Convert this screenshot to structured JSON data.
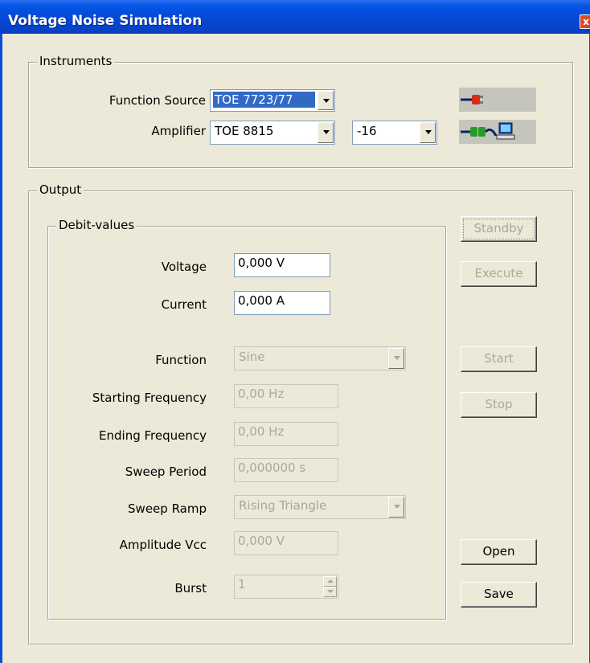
{
  "window": {
    "title": "Voltage Noise Simulation",
    "close_glyph": "x"
  },
  "instruments": {
    "legend": "Instruments",
    "function_source": {
      "label": "Function Source",
      "value": "TOE 7723/77"
    },
    "amplifier": {
      "label": "Amplifier",
      "value": "TOE 8815",
      "range_value": "-16"
    },
    "icons": {
      "function_source": "red-plug-disconnected-icon",
      "amplifier": "green-plug-connected-computer-icon"
    }
  },
  "output": {
    "legend": "Output",
    "debit": {
      "legend": "Debit-values",
      "voltage": {
        "label": "Voltage",
        "value": "0,000 V"
      },
      "current": {
        "label": "Current",
        "value": "0,000 A"
      },
      "function": {
        "label": "Function",
        "value": "Sine"
      },
      "starting_frequency": {
        "label": "Starting Frequency",
        "value": "0,00 Hz"
      },
      "ending_frequency": {
        "label": "Ending Frequency",
        "value": "0,00 Hz"
      },
      "sweep_period": {
        "label": "Sweep Period",
        "value": "0,000000 s"
      },
      "sweep_ramp": {
        "label": "Sweep Ramp",
        "value": "Rising Triangle"
      },
      "amplitude_vcc": {
        "label": "Amplitude Vcc",
        "value": "0,000 V"
      },
      "burst": {
        "label": "Burst",
        "value": "1"
      }
    },
    "buttons": {
      "standby": "Standby",
      "execute": "Execute",
      "start": "Start",
      "stop": "Stop",
      "open": "Open",
      "save": "Save"
    }
  },
  "colors": {
    "title_bar": "#0448d6",
    "dialog_bg": "#ece9d8",
    "disabled_text": "#aca899",
    "selection": "#316ac5"
  }
}
